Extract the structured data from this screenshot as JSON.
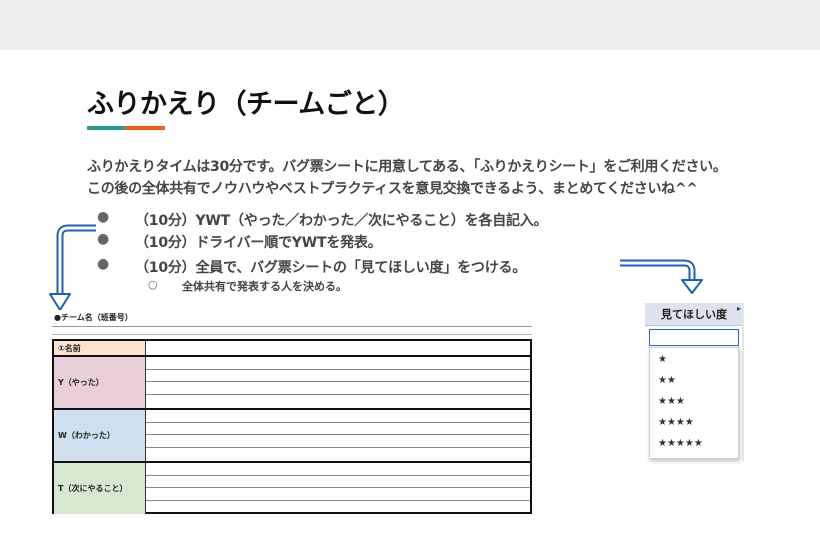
{
  "title": "ふりかえり（チームごと）",
  "intro": [
    "ふりかえりタイムは30分です。バグ票シートに用意してある、「ふりかえりシート」をご利用ください。",
    "この後の全体共有でノウハウやベストプラクティスを意見交換できるよう、まとめてくださいね^^"
  ],
  "bullets": [
    {
      "marker": "●",
      "text": "（10分）YWT（やった／わかった／次にやること）を各自記入。"
    },
    {
      "marker": "●",
      "text": "（10分）ドライバー順でYWTを発表。"
    },
    {
      "marker": "●",
      "text": "（10分）全員で、バグ票シートの「見てほしい度」をつける。"
    }
  ],
  "sub_bullet": {
    "marker": "○",
    "text": "全体共有で発表する人を決める。"
  },
  "sheet": {
    "team_label": "●チーム名（班番号）",
    "rows": [
      {
        "label": "①名前",
        "color": "#fbe3cf"
      },
      {
        "label": "Y（やった）",
        "color": "#e9cfd9"
      },
      {
        "label": "W（わかった）",
        "color": "#cfe0f0"
      },
      {
        "label": "T（次にやること）",
        "color": "#d6e8cf"
      }
    ]
  },
  "dropdown": {
    "header": "見てほしい度",
    "header_mark": "▸",
    "input_value": "",
    "options": [
      "★",
      "★★",
      "★★★",
      "★★★★",
      "★★★★★"
    ]
  },
  "colors": {
    "accent_teal": "#2a9d8f",
    "accent_orange": "#e8621d",
    "arrow_blue": "#1f5fb4"
  }
}
